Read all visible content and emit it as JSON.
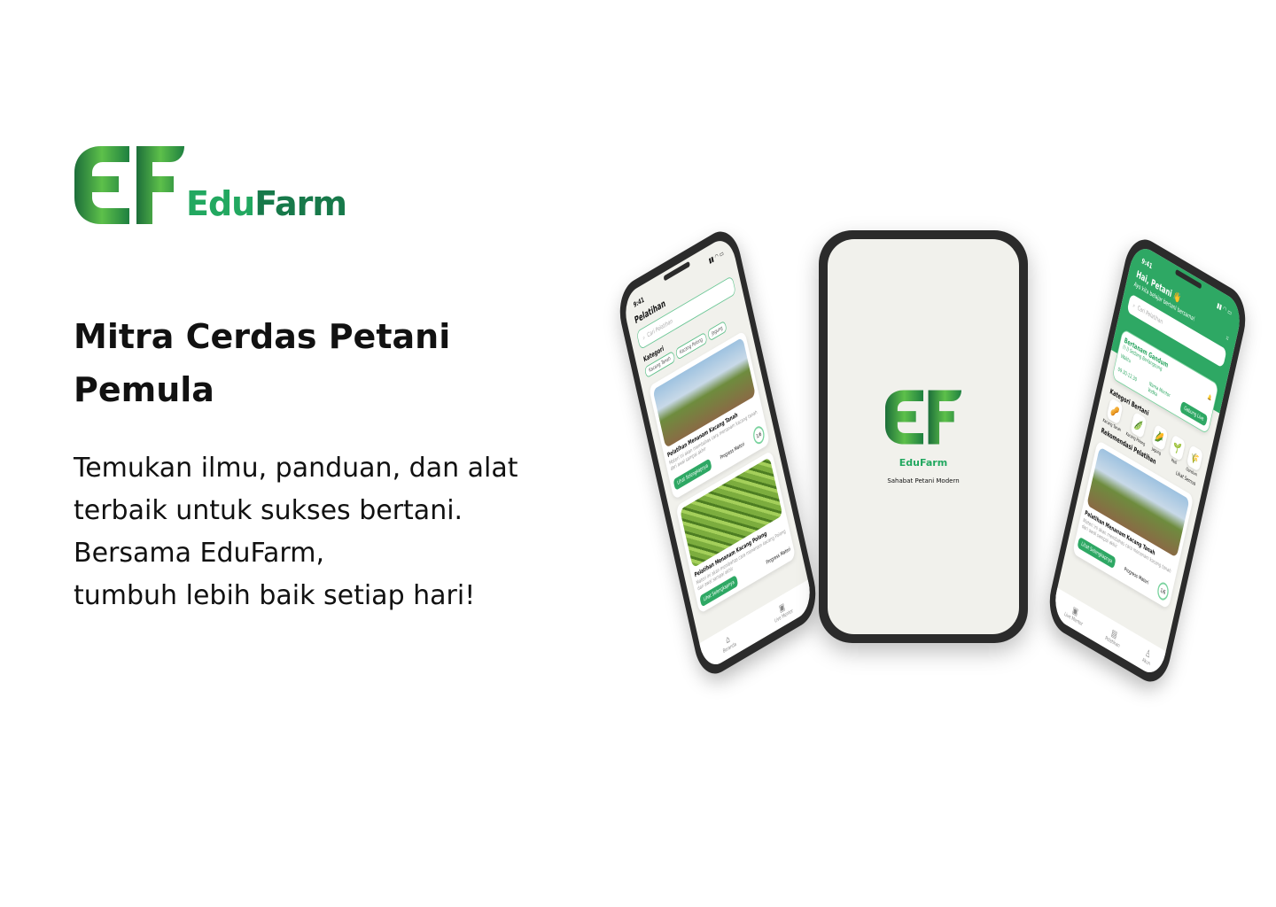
{
  "brand": {
    "name_a": "Edu",
    "name_b": "Farm",
    "logo_text": "EF"
  },
  "headline": "Mitra Cerdas Petani Pemula",
  "body": [
    "Temukan ilmu, panduan, dan alat",
    "terbaik untuk sukses bertani.",
    "Bersama EduFarm,",
    "tumbuh lebih baik setiap hari!"
  ],
  "left_phone": {
    "time": "9:41",
    "title": "Pelatihan",
    "search_placeholder": "Cari Pelatihan",
    "category_label": "Kategori",
    "chips": [
      "Kacang Tanah",
      "Kacang Polong",
      "Jagung"
    ],
    "cards": [
      {
        "title": "Pelatihan Menanam Kacang Tanah",
        "desc": "Materi ini akan membahas cara menanam kacang tanah dari awal sampai akhir",
        "button": "Lihat Selengkapnya",
        "progress_label": "Progress Materi",
        "progress": "1/6"
      },
      {
        "title": "Pelatihan Menanam Kacang Polong",
        "desc": "Materi ini akan membahas cara menanam kacang Polong dari awal sampai akhir",
        "button": "Lihat Selengkapnya",
        "progress_label": "Progress Materi"
      }
    ],
    "nav": [
      "Beranda",
      "Live Mentor"
    ]
  },
  "center_phone": {
    "app_name": "EduFarm",
    "tagline": "Sahabat Petani Modern"
  },
  "right_phone": {
    "time": "9:41",
    "greeting": "Hai, Petani 👋",
    "subtitle": "Ayo kita belajar bertani bersama!",
    "search_placeholder": "Cari Pelatihan",
    "live": {
      "title": "Bertanam Gandum",
      "status": "((·)) Sedang Berlangsung",
      "time_label": "Waktu",
      "time": "09.30-12.30",
      "mentor_label": "Nama Mentor",
      "mentor": "Vodka",
      "button": "Gabung Live"
    },
    "category_label": "Kategori Bertani",
    "categories": [
      "Kacang Tanah",
      "Kacang Polong",
      "Jagung",
      "Padi",
      "Gandum"
    ],
    "rec_label": "Rekomendasi Pelatihan",
    "see_all": "Lihat Semua",
    "card": {
      "title": "Pelatihan Menanam Kacang Tanah",
      "desc": "Materi ini akan membahas cara menanam kacang tanah dari awal sampai akhir",
      "button": "Lihat Selengkapnya",
      "progress_label": "Progress Materi",
      "progress": "1/6"
    },
    "nav": [
      "Live Mentor",
      "Pelatihan",
      "Akun"
    ]
  },
  "colors": {
    "primary": "#2ea864",
    "dark": "#17794a",
    "bg": "#f1f1ec"
  }
}
